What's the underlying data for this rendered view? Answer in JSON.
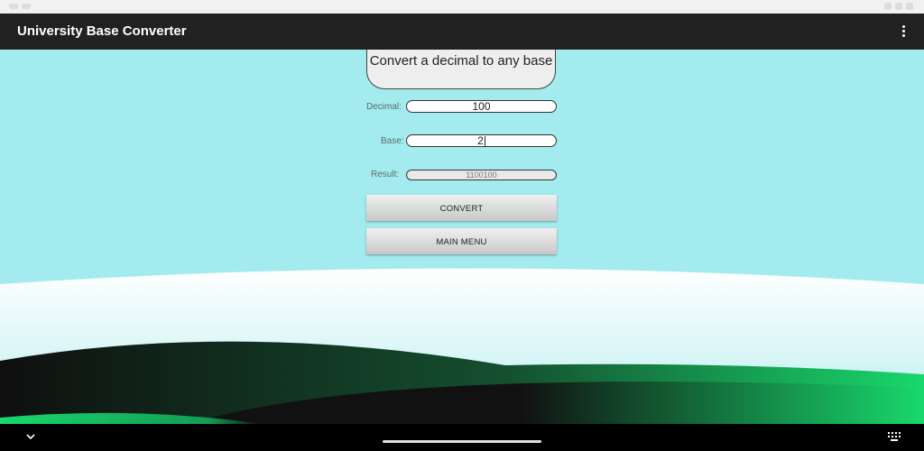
{
  "app": {
    "title": "University Base Converter"
  },
  "form": {
    "heading": "Convert a decimal to any base",
    "decimal_label": "Decimal:",
    "decimal_value": "100",
    "base_label": "Base:",
    "base_value": "2",
    "result_label": "Result:",
    "result_value": "1100100"
  },
  "buttons": {
    "convert": "CONVERT",
    "main_menu": "MAIN MENU"
  },
  "icons": {
    "overflow": "more-vert-icon",
    "back": "chevron-down-icon",
    "keyboard": "keyboard-icon"
  },
  "colors": {
    "app_bar": "#212121",
    "background": "#a3ebee",
    "hill_green": "#18d86c",
    "hill_dark": "#111111"
  }
}
